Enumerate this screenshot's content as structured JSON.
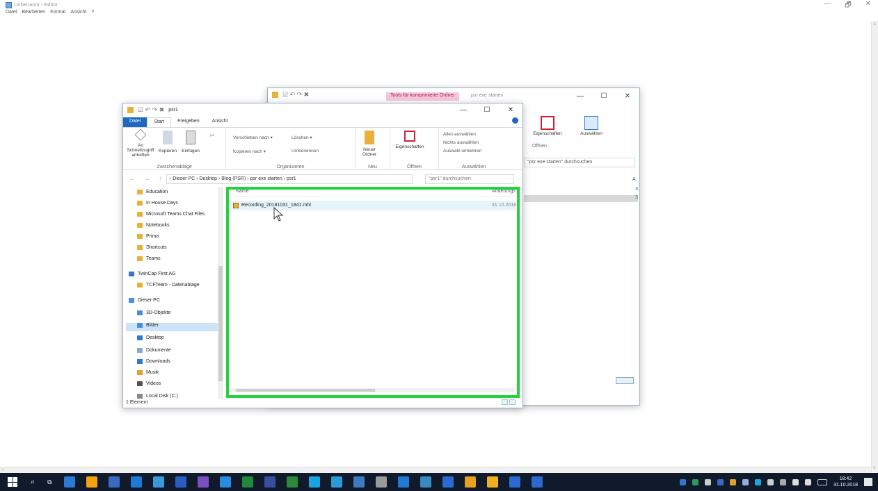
{
  "notepad": {
    "title": "Unbenannt - Editor",
    "menu": [
      "Datei",
      "Bearbeiten",
      "Format",
      "Ansicht",
      "?"
    ],
    "controls": [
      "—",
      "🗗",
      "✕"
    ]
  },
  "back_window": {
    "context_tab": "Tools für komprimierte Ordner",
    "title": "psr exe starten",
    "controls": [
      "—",
      "☐",
      "✕"
    ],
    "ribbon": {
      "properties_label": "Eigenschaften",
      "select_label": "Auswählen",
      "open_group": "Öffnen"
    },
    "search_placeholder": "\"psr exe starten\" durchsuchen",
    "col_partial": "A",
    "values_partial": [
      "3",
      "3"
    ]
  },
  "front_window": {
    "title": "psr1",
    "controls": [
      "—",
      "☐",
      "✕"
    ],
    "tabs": [
      "Datei",
      "Start",
      "Freigeben",
      "Ansicht"
    ],
    "ribbon": {
      "pin_label": "An Schnellzugriff anheften",
      "copy_label": "Kopieren",
      "paste_label": "Einfügen",
      "clipboard_group": "Zwischenablage",
      "move_to": "Verschieben nach ▾",
      "copy_to": "Kopieren nach ▾",
      "delete": "Löschen ▾",
      "rename": "Umbenennen",
      "organize_group": "Organisieren",
      "new_folder": "Neuer Ordner",
      "new_group": "Neu",
      "properties": "Eigenschaften",
      "open_group": "Öffnen",
      "select_all": "Alles auswählen",
      "select_none": "Nichts auswählen",
      "invert_selection": "Auswahl umkehren",
      "select_group": "Auswählen"
    },
    "nav_buttons": "← → ↑",
    "address_path": "› Dieser PC › Desktop › Blog (PSR) › psr exe starten › psr1",
    "search_placeholder": "\"psr1\" durchsuchen",
    "nav_items": [
      {
        "label": "Education",
        "color": "#e8b23a"
      },
      {
        "label": "In House Days",
        "color": "#e8b23a"
      },
      {
        "label": "Microsoft Teams Chat Files",
        "color": "#e8b23a"
      },
      {
        "label": "Notebooks",
        "color": "#e8b23a"
      },
      {
        "label": "Prima",
        "color": "#e8b23a"
      },
      {
        "label": "Shortcuts",
        "color": "#e8b23a"
      },
      {
        "label": "Teams",
        "color": "#e8b23a"
      },
      {
        "label": "TwinCap First AG",
        "color": "#3b73c9"
      },
      {
        "label": "TCFTeam - Datenablage",
        "color": "#e8b23a"
      },
      {
        "label": "Dieser PC",
        "color": "#4b8fd9"
      },
      {
        "label": "3D-Objekte",
        "color": "#4b8fd9"
      },
      {
        "label": "Bilder",
        "color": "#4b8fd9"
      },
      {
        "label": "Desktop",
        "color": "#2b7ad1"
      },
      {
        "label": "Dokumente",
        "color": "#8aa9c9"
      },
      {
        "label": "Downloads",
        "color": "#2b7ad1"
      },
      {
        "label": "Musik",
        "color": "#e0a030"
      },
      {
        "label": "Videos",
        "color": "#555555"
      },
      {
        "label": "Local Disk (C:)",
        "color": "#888888"
      }
    ],
    "columns": {
      "name": "Name",
      "modified": "Änderungs"
    },
    "files": [
      {
        "name": "Recording_20181031_1841.mht",
        "date": "31.10.2018"
      }
    ],
    "status": "1 Element"
  },
  "taskbar": {
    "apps": [
      "#2b7ad1",
      "#f2a30f",
      "#3a6ac0",
      "#1f7ad6",
      "#3a9ad9",
      "#2b5cc4",
      "#7b4fc2",
      "#2a8ae0",
      "#1e8a3a",
      "#3a4ea0",
      "#2a8a3a",
      "#1aa4e0",
      "#2b9ad9",
      "#3d7ac0",
      "#9a9a9a",
      "#1f7ad6",
      "#3a8ac0",
      "#2b6ad0",
      "#e8a020",
      "#f0b020",
      "#2b6ad0",
      "#2b6ad0"
    ],
    "clock_time": "18:42",
    "clock_date": "31.10.2018"
  },
  "colors": {
    "highlight": "#22d33a",
    "file_tab": "#1e68c2",
    "taskbar": "#101a2b"
  }
}
